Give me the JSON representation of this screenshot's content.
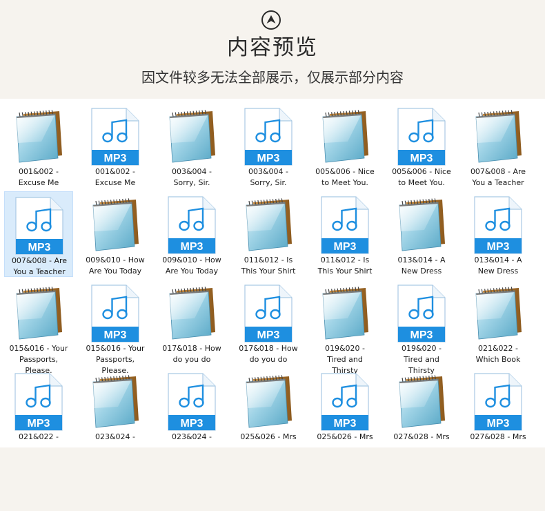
{
  "header": {
    "title": "内容预览",
    "subtitle": "因文件较多无法全部展示，仅展示部分内容"
  },
  "colors": {
    "page_background": "#f6f3ee",
    "panel_background": "#ffffff",
    "mp3_blue": "#1e8fe0",
    "selection": "#d9ebfb"
  },
  "mp3_badge_text": "MP3",
  "files": [
    {
      "type": "notepad",
      "label": "001&002 -\nExcuse Me"
    },
    {
      "type": "mp3",
      "label": "001&002 -\nExcuse Me"
    },
    {
      "type": "notepad",
      "label": "003&004 -\nSorry, Sir."
    },
    {
      "type": "mp3",
      "label": "003&004 -\nSorry, Sir."
    },
    {
      "type": "notepad",
      "label": "005&006 - Nice\nto Meet You."
    },
    {
      "type": "mp3",
      "label": "005&006 - Nice\nto Meet You."
    },
    {
      "type": "notepad",
      "label": "007&008 - Are\nYou a Teacher"
    },
    {
      "type": "mp3",
      "label": "007&008 - Are\nYou a Teacher",
      "selected": true
    },
    {
      "type": "notepad",
      "label": "009&010 - How\nAre You Today"
    },
    {
      "type": "mp3",
      "label": "009&010 - How\nAre You Today"
    },
    {
      "type": "notepad",
      "label": "011&012 - Is\nThis Your Shirt"
    },
    {
      "type": "mp3",
      "label": "011&012 - Is\nThis Your Shirt"
    },
    {
      "type": "notepad",
      "label": "013&014 - A\nNew Dress"
    },
    {
      "type": "mp3",
      "label": "013&014 - A\nNew Dress"
    },
    {
      "type": "notepad",
      "label": "015&016 - Your\nPassports,\nPlease."
    },
    {
      "type": "mp3",
      "label": "015&016 - Your\nPassports,\nPlease."
    },
    {
      "type": "notepad",
      "label": "017&018 - How\ndo you do"
    },
    {
      "type": "mp3",
      "label": "017&018 - How\ndo you do"
    },
    {
      "type": "notepad",
      "label": "019&020 -\nTired and\nThirsty"
    },
    {
      "type": "mp3",
      "label": "019&020 -\nTired and\nThirsty"
    },
    {
      "type": "notepad",
      "label": "021&022 -\nWhich Book"
    },
    {
      "type": "mp3",
      "label": "021&022 -"
    },
    {
      "type": "notepad",
      "label": "023&024 -"
    },
    {
      "type": "mp3",
      "label": "023&024 -"
    },
    {
      "type": "notepad",
      "label": "025&026 - Mrs"
    },
    {
      "type": "mp3",
      "label": "025&026 - Mrs"
    },
    {
      "type": "notepad",
      "label": "027&028 - Mrs"
    },
    {
      "type": "mp3",
      "label": "027&028 - Mrs"
    }
  ]
}
